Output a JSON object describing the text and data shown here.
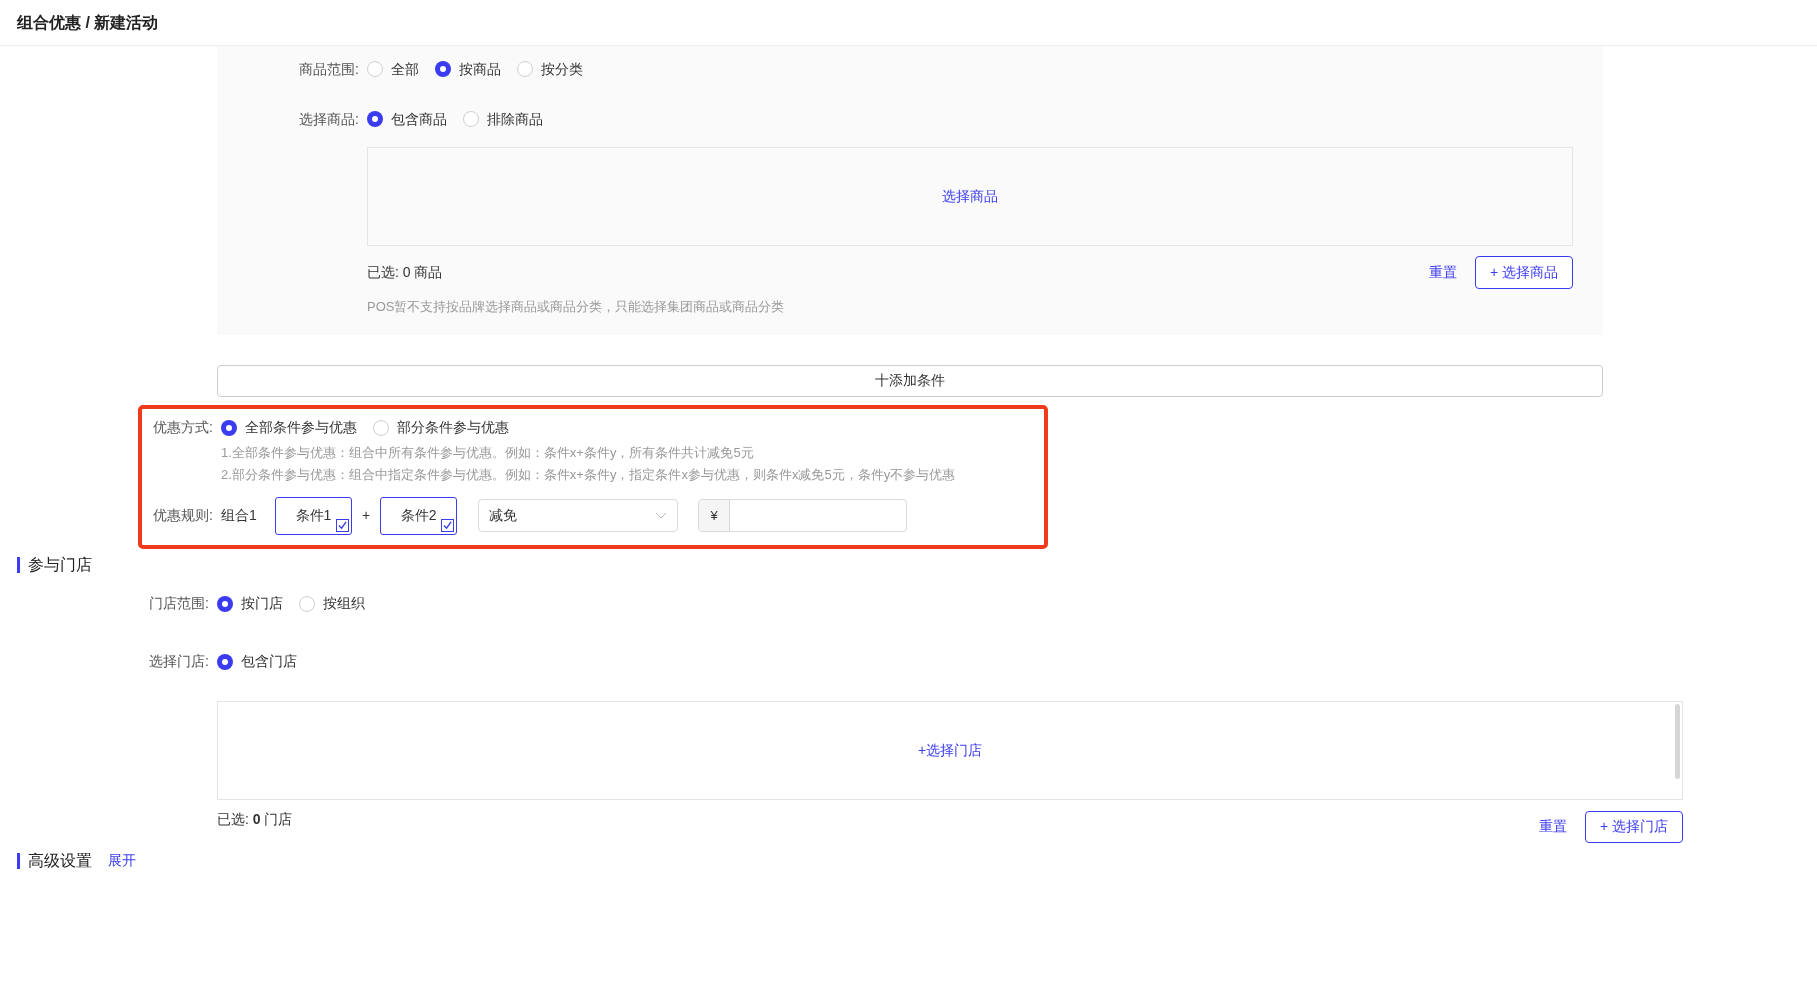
{
  "breadcrumb": "组合优惠 / 新建活动",
  "goods_scope": {
    "label": "商品范围:",
    "options": [
      {
        "label": "全部",
        "selected": false
      },
      {
        "label": "按商品",
        "selected": true
      },
      {
        "label": "按分类",
        "selected": false
      }
    ]
  },
  "goods_select": {
    "label": "选择商品:",
    "options": [
      {
        "label": "包含商品",
        "selected": true
      },
      {
        "label": "排除商品",
        "selected": false
      }
    ]
  },
  "goods_box": {
    "link": "选择商品",
    "count_prefix": "已选: ",
    "count": "0",
    "count_suffix": " 商品",
    "reset": "重置",
    "add_button": "+ 选择商品",
    "note": "POS暂不支持按品牌选择商品或商品分类，只能选择集团商品或商品分类"
  },
  "add_condition": "十添加条件",
  "discount_mode": {
    "label": "优惠方式:",
    "options": [
      {
        "label": "全部条件参与优惠",
        "selected": true
      },
      {
        "label": "部分条件参与优惠",
        "selected": false
      }
    ],
    "hints": [
      "1.全部条件参与优惠：组合中所有条件参与优惠。例如：条件x+条件y，所有条件共计减免5元",
      "2.部分条件参与优惠：组合中指定条件参与优惠。例如：条件x+条件y，指定条件x参与优惠，则条件x减免5元，条件y不参与优惠"
    ]
  },
  "discount_rule": {
    "label": "优惠规则:",
    "group": "组合1",
    "conditions": [
      {
        "label": "条件1",
        "checked": true
      },
      {
        "label": "条件2",
        "checked": true
      }
    ],
    "plus": "+",
    "select_value": "减免",
    "currency": "¥"
  },
  "stores_section": {
    "title": "参与门店",
    "scope": {
      "label": "门店范围:",
      "options": [
        {
          "label": "按门店",
          "selected": true
        },
        {
          "label": "按组织",
          "selected": false
        }
      ]
    },
    "select": {
      "label": "选择门店:",
      "options": [
        {
          "label": "包含门店",
          "selected": true
        }
      ]
    },
    "box": {
      "link": "+选择门店",
      "count_prefix": "已选: ",
      "count": "0",
      "count_suffix": " 门店",
      "reset": "重置",
      "add_button": "+ 选择门店"
    }
  },
  "advanced": {
    "title": "高级设置",
    "toggle": "展开"
  }
}
